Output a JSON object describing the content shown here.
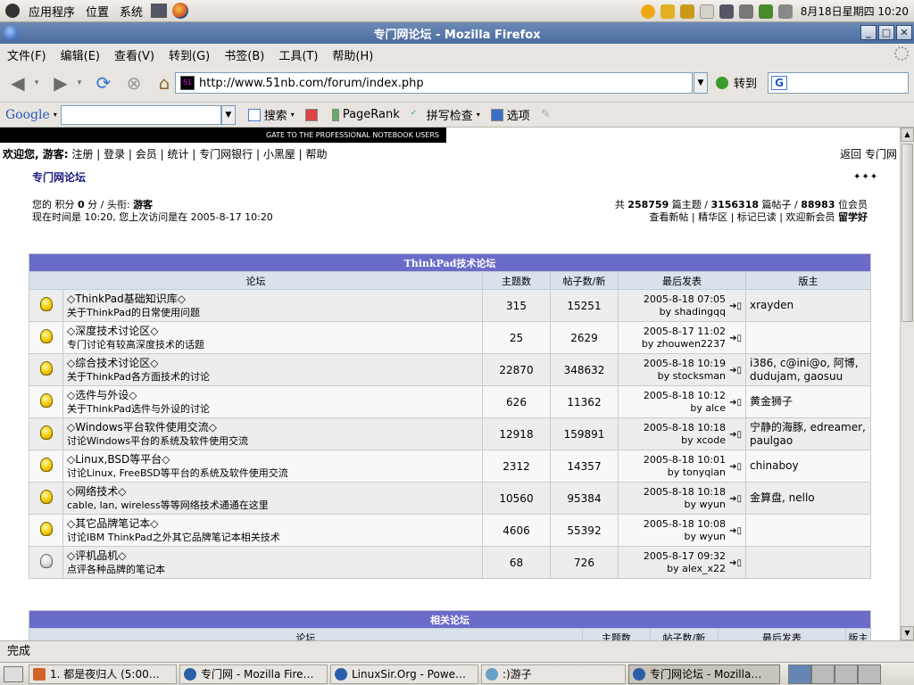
{
  "top_panel": {
    "menus": [
      "应用程序",
      "位置",
      "系统"
    ],
    "clock": "8月18日星期四 10:20"
  },
  "window": {
    "title": "专门网论坛 - Mozilla Firefox"
  },
  "menubar": [
    "文件(F)",
    "编辑(E)",
    "查看(V)",
    "转到(G)",
    "书签(B)",
    "工具(T)",
    "帮助(H)"
  ],
  "nav": {
    "url": "http://www.51nb.com/forum/index.php",
    "go_label": "转到"
  },
  "google_bar": {
    "logo": "Google",
    "search_label": "搜索",
    "pagerank_label": "PageRank",
    "spell_label": "拼写检查",
    "options_label": "选项"
  },
  "page": {
    "banner": "GATE TO THE PROFESSIONAL NOTEBOOK USERS",
    "welcome_prefix": "欢迎您, 游客:",
    "nav_links": [
      "注册",
      "登录",
      "会员",
      "统计",
      "专门网银行",
      "小黑屋",
      "帮助"
    ],
    "back_home": "返回 专门网",
    "breadcrumb": "专门网论坛",
    "arrows": "✦✦✦",
    "user_line": {
      "points_label": "您的 积分",
      "points": "0",
      "unit": "分 / 头衔:",
      "rank": "游客"
    },
    "time_line": "现在时间是 10:20, 您上次访问是在 2005-8-17 10:20",
    "stats": {
      "prefix": "共",
      "topics": "258759",
      "topics_label": "篇主题 /",
      "posts": "3156318",
      "posts_label": "篇帖子 /",
      "members": "88983",
      "members_label": "位会员"
    },
    "stat_links": [
      "查看新帖",
      "精华区",
      "标记已读",
      "欢迎新会员"
    ],
    "newest_member": "留学好"
  },
  "forum_table": {
    "caption": "ThinkPad技术论坛",
    "headers": [
      "论坛",
      "主题数",
      "帖子数/新",
      "最后发表",
      "版主"
    ],
    "rows": [
      {
        "name": "◇ThinkPad基础知识库◇",
        "desc": "关于ThinkPad的日常使用问题",
        "topics": "315",
        "posts": "15251",
        "last_time": "2005-8-18 07:05",
        "last_by": "by shadingqq",
        "mods": "xrayden",
        "icon": "bulb-on"
      },
      {
        "name": "◇深度技术讨论区◇",
        "desc": "专门讨论有较高深度技术的话题",
        "topics": "25",
        "posts": "2629",
        "last_time": "2005-8-17 11:02",
        "last_by": "by zhouwen2237",
        "mods": "",
        "icon": "bulb-on"
      },
      {
        "name": "◇综合技术讨论区◇",
        "desc": "关于ThinkPad各方面技术的讨论",
        "topics": "22870",
        "posts": "348632",
        "last_time": "2005-8-18 10:19",
        "last_by": "by stocksman",
        "mods": "i386, c@ini@o, 阿博, dudujam, gaosuu",
        "icon": "bulb-on"
      },
      {
        "name": "◇选件与外设◇",
        "desc": "关于ThinkPad选件与外设的讨论",
        "topics": "626",
        "posts": "11362",
        "last_time": "2005-8-18 10:12",
        "last_by": "by alce",
        "mods": "黄金狮子",
        "icon": "bulb-on"
      },
      {
        "name": "◇Windows平台软件使用交流◇",
        "desc": "讨论Windows平台的系统及软件使用交流",
        "topics": "12918",
        "posts": "159891",
        "last_time": "2005-8-18 10:18",
        "last_by": "by xcode",
        "mods": "宁静的海豚, edreamer, paulgao",
        "icon": "bulb-on"
      },
      {
        "name": "◇Linux,BSD等平台◇",
        "desc": "讨论Linux, FreeBSD等平台的系统及软件使用交流",
        "topics": "2312",
        "posts": "14357",
        "last_time": "2005-8-18 10:01",
        "last_by": "by tonyqian",
        "mods": "chinaboy",
        "icon": "bulb-on"
      },
      {
        "name": "◇网络技术◇",
        "desc": "cable, lan, wireless等等网络技术通通在这里",
        "topics": "10560",
        "posts": "95384",
        "last_time": "2005-8-18 10:18",
        "last_by": "by wyun",
        "mods": "金算盘, nello",
        "icon": "bulb-on"
      },
      {
        "name": "◇其它品牌笔记本◇",
        "desc": "讨论IBM ThinkPad之外其它品牌笔记本相关技术",
        "topics": "4606",
        "posts": "55392",
        "last_time": "2005-8-18 10:08",
        "last_by": "by wyun",
        "mods": "",
        "icon": "bulb-on"
      },
      {
        "name": "◇评机品机◇",
        "desc": "点评各种品牌的笔记本",
        "topics": "68",
        "posts": "726",
        "last_time": "2005-8-17 09:32",
        "last_by": "by alex_x22",
        "mods": "",
        "icon": "bulb-off"
      }
    ]
  },
  "related_table": {
    "caption": "相关论坛",
    "headers": [
      "论坛",
      "主题数",
      "帖子数/新",
      "最后发表",
      "版主"
    ]
  },
  "statusbar": {
    "text": "完成"
  },
  "taskbar": {
    "tasks": [
      "1. 都是夜归人 (5:00…",
      "专门网 - Mozilla Fire…",
      "LinuxSir.Org - Powe…",
      ":)游子",
      "专门网论坛 - Mozilla…"
    ]
  }
}
